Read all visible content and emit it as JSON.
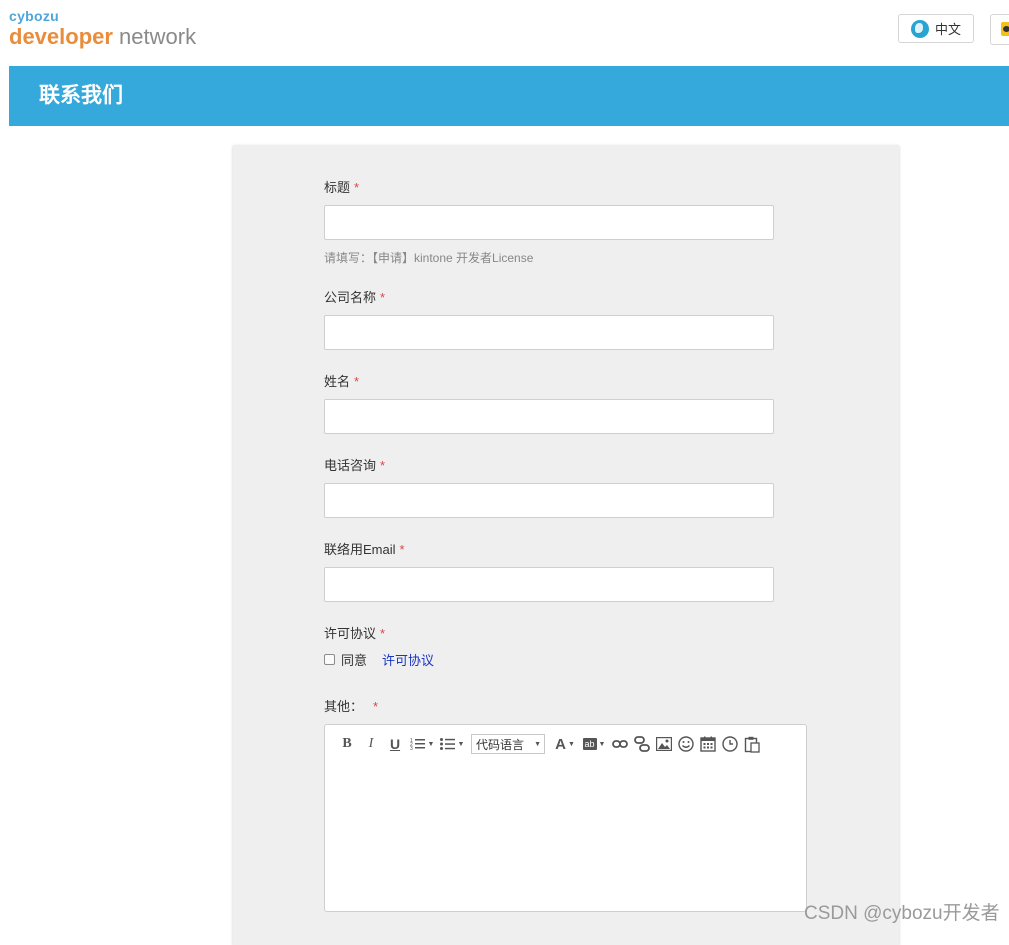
{
  "brand": {
    "top": "cybozu",
    "dev": "developer",
    "net": " network"
  },
  "header": {
    "lang_label": "中文"
  },
  "banner": {
    "title": "联系我们"
  },
  "form": {
    "required_mark": "*",
    "title_label": "标题",
    "title_hint": "请填写：【申请】kintone 开发者License",
    "company_label": "公司名称",
    "name_label": "姓名",
    "phone_label": "电话咨询",
    "email_label": "联络用Email",
    "license_label": "许可协议",
    "agree_label": "同意",
    "agree_link": "许可协议",
    "other_label": "其他："
  },
  "editor": {
    "bold": "B",
    "italic": "I",
    "underline": "U",
    "code_lang": "代码语言",
    "font_color": "A",
    "bg_color": "ab"
  },
  "watermark": "CSDN @cybozu开发者"
}
